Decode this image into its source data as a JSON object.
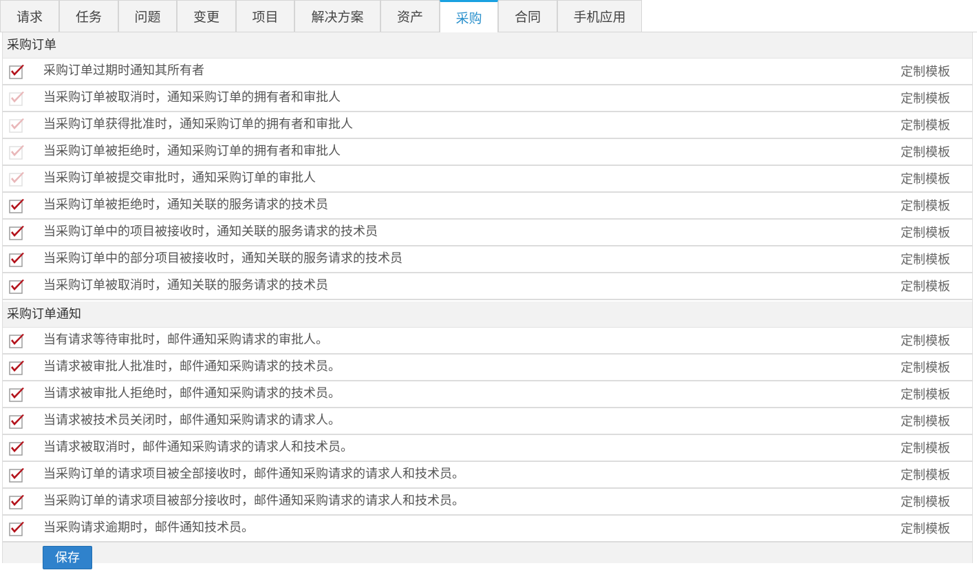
{
  "tabs": [
    {
      "label": "请求",
      "active": false
    },
    {
      "label": "任务",
      "active": false
    },
    {
      "label": "问题",
      "active": false
    },
    {
      "label": "变更",
      "active": false
    },
    {
      "label": "项目",
      "active": false
    },
    {
      "label": "解决方案",
      "active": false
    },
    {
      "label": "资产",
      "active": false
    },
    {
      "label": "采购",
      "active": true
    },
    {
      "label": "合同",
      "active": false
    },
    {
      "label": "手机应用",
      "active": false
    }
  ],
  "sections": [
    {
      "title": "采购订单",
      "rows": [
        {
          "label": "采购订单过期时通知其所有者",
          "checked": true,
          "disabled": false,
          "link": "定制模板"
        },
        {
          "label": "当采购订单被取消时，通知采购订单的拥有者和审批人",
          "checked": true,
          "disabled": true,
          "link": "定制模板"
        },
        {
          "label": "当采购订单获得批准时，通知采购订单的拥有者和审批人",
          "checked": true,
          "disabled": true,
          "link": "定制模板"
        },
        {
          "label": "当采购订单被拒绝时，通知采购订单的拥有者和审批人",
          "checked": true,
          "disabled": true,
          "link": "定制模板"
        },
        {
          "label": "当采购订单被提交审批时，通知采购订单的审批人",
          "checked": true,
          "disabled": true,
          "link": "定制模板"
        },
        {
          "label": "当采购订单被拒绝时，通知关联的服务请求的技术员",
          "checked": true,
          "disabled": false,
          "link": "定制模板"
        },
        {
          "label": "当采购订单中的项目被接收时，通知关联的服务请求的技术员",
          "checked": true,
          "disabled": false,
          "link": "定制模板"
        },
        {
          "label": "当采购订单中的部分项目被接收时，通知关联的服务请求的技术员",
          "checked": true,
          "disabled": false,
          "link": "定制模板"
        },
        {
          "label": "当采购订单被取消时，通知关联的服务请求的技术员",
          "checked": true,
          "disabled": false,
          "link": "定制模板"
        }
      ]
    },
    {
      "title": "采购订单通知",
      "rows": [
        {
          "label": "当有请求等待审批时，邮件通知采购请求的审批人。",
          "checked": true,
          "disabled": false,
          "link": "定制模板"
        },
        {
          "label": "当请求被审批人批准时，邮件通知采购请求的技术员。",
          "checked": true,
          "disabled": false,
          "link": "定制模板"
        },
        {
          "label": "当请求被审批人拒绝时，邮件通知采购请求的技术员。",
          "checked": true,
          "disabled": false,
          "link": "定制模板"
        },
        {
          "label": "当请求被技术员关闭时，邮件通知采购请求的请求人。",
          "checked": true,
          "disabled": false,
          "link": "定制模板"
        },
        {
          "label": "当请求被取消时，邮件通知采购请求的请求人和技术员。",
          "checked": true,
          "disabled": false,
          "link": "定制模板"
        },
        {
          "label": "当采购订单的请求项目被全部接收时，邮件通知采购请求的请求人和技术员。",
          "checked": true,
          "disabled": false,
          "link": "定制模板"
        },
        {
          "label": "当采购订单的请求项目被部分接收时，邮件通知采购请求的请求人和技术员。",
          "checked": true,
          "disabled": false,
          "link": "定制模板"
        },
        {
          "label": "当采购请求逾期时，邮件通知技术员。",
          "checked": true,
          "disabled": false,
          "link": "定制模板"
        }
      ]
    }
  ],
  "footer": {
    "save_label": "保存"
  },
  "colors": {
    "active_tab_accent": "#1aa1e1",
    "check_mark": "#b3121b",
    "check_mark_disabled": "#e9b7b9",
    "save_button": "#2f82cc"
  }
}
